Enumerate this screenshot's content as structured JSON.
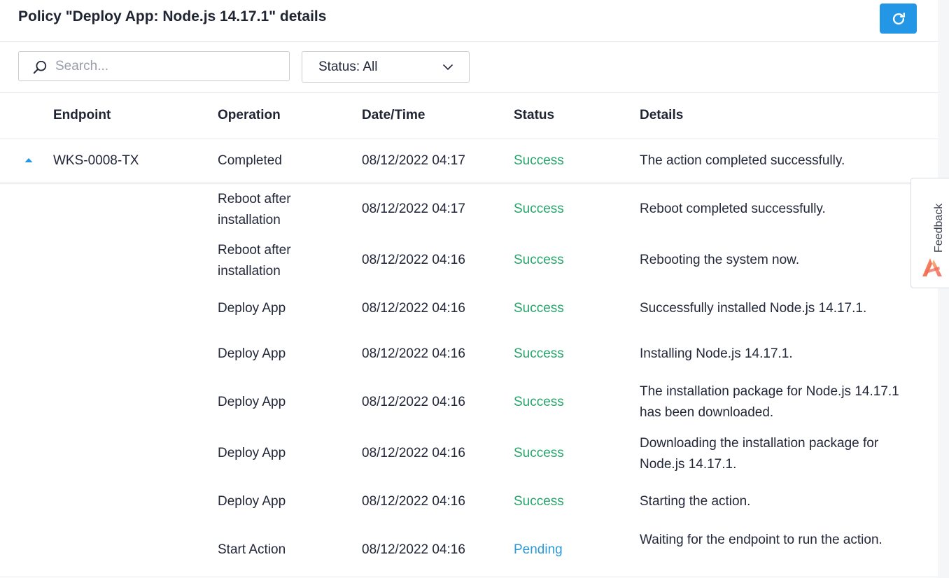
{
  "header": {
    "title": "Policy \"Deploy App: Node.js 14.17.1\" details",
    "refresh_icon": "refresh-icon",
    "accent_color": "#2496e6"
  },
  "toolbar": {
    "search": {
      "placeholder": "Search...",
      "value": "",
      "icon": "search-icon"
    },
    "status_filter": {
      "label": "Status: All",
      "icon": "chevron-down-icon"
    }
  },
  "table": {
    "columns": [
      "Endpoint",
      "Operation",
      "Date/Time",
      "Status",
      "Details"
    ],
    "parent_row": {
      "expanded": true,
      "endpoint": "WKS-0008-TX",
      "operation": "Completed",
      "datetime": "08/12/2022 04:17",
      "status": "Success",
      "details": "The action completed successfully."
    },
    "child_rows": [
      {
        "operation": "Reboot after installation",
        "datetime": "08/12/2022 04:17",
        "status": "Success",
        "details": "Reboot completed successfully."
      },
      {
        "operation": "Reboot after installation",
        "datetime": "08/12/2022 04:16",
        "status": "Success",
        "details": "Rebooting the system now."
      },
      {
        "operation": "Deploy App",
        "datetime": "08/12/2022 04:16",
        "status": "Success",
        "details": "Successfully installed Node.js 14.17.1."
      },
      {
        "operation": "Deploy App",
        "datetime": "08/12/2022 04:16",
        "status": "Success",
        "details": "Installing Node.js 14.17.1."
      },
      {
        "operation": "Deploy App",
        "datetime": "08/12/2022 04:16",
        "status": "Success",
        "details": "The installation package for Node.js 14.17.1 has been downloaded."
      },
      {
        "operation": "Deploy App",
        "datetime": "08/12/2022 04:16",
        "status": "Success",
        "details": "Downloading the installation package for Node.js 14.17.1."
      },
      {
        "operation": "Deploy App",
        "datetime": "08/12/2022 04:16",
        "status": "Success",
        "details": "Starting the action."
      },
      {
        "operation": "Start Action",
        "datetime": "08/12/2022 04:16",
        "status": "Pending",
        "details": "Waiting for the endpoint to run the action."
      }
    ],
    "status_colors": {
      "Success": "#27a56b",
      "Pending": "#2a9ad8"
    }
  },
  "feedback": {
    "label": "Feedback",
    "icon": "feedback-logo-icon"
  }
}
